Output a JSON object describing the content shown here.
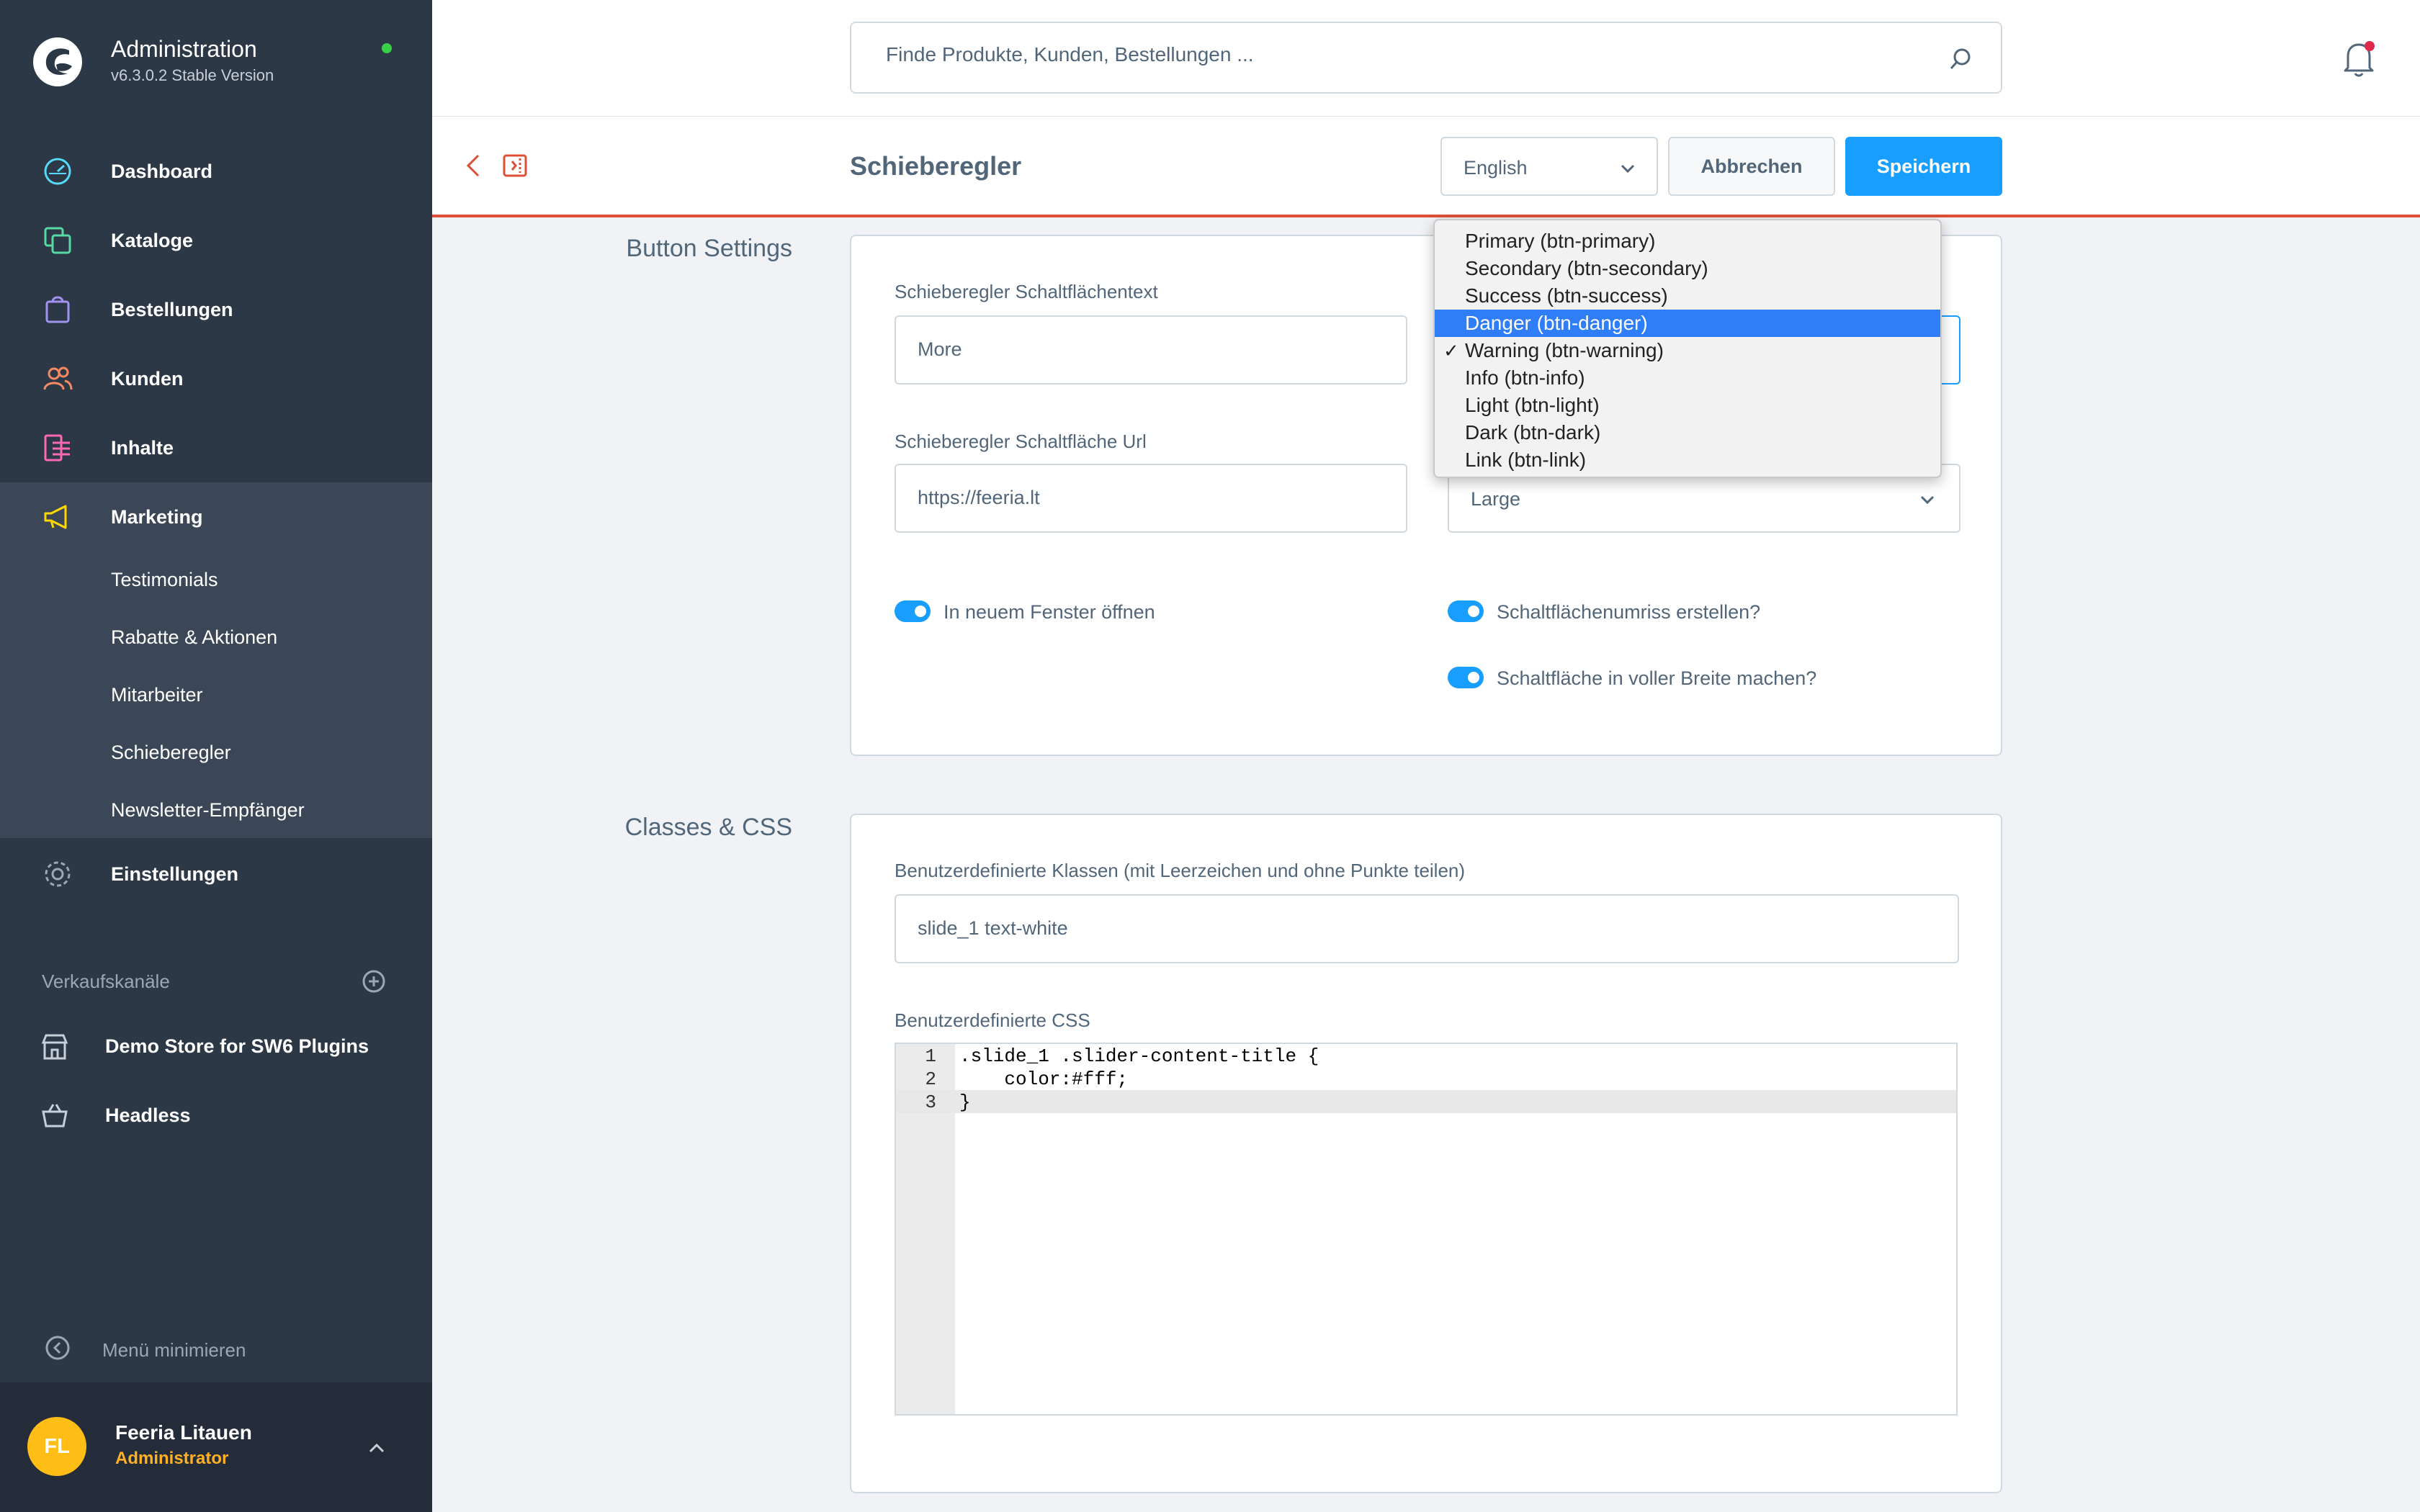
{
  "brand": {
    "title": "Administration",
    "version": "v6.3.0.2 Stable Version",
    "status_color": "#37d046"
  },
  "nav": {
    "items": [
      {
        "label": "Dashboard",
        "icon": "dashboard-icon",
        "color": "#57d9f7"
      },
      {
        "label": "Kataloge",
        "icon": "catalog-icon",
        "color": "#57d9a3"
      },
      {
        "label": "Bestellungen",
        "icon": "orders-icon",
        "color": "#a092f0"
      },
      {
        "label": "Kunden",
        "icon": "customers-icon",
        "color": "#f88962"
      },
      {
        "label": "Inhalte",
        "icon": "content-icon",
        "color": "#ff68b4"
      },
      {
        "label": "Marketing",
        "icon": "marketing-icon",
        "color": "#ffd700"
      },
      {
        "label": "Einstellungen",
        "icon": "settings-icon",
        "color": "#9aa8b5"
      }
    ],
    "marketing_sub": [
      {
        "label": "Testimonials"
      },
      {
        "label": "Rabatte & Aktionen"
      },
      {
        "label": "Mitarbeiter"
      },
      {
        "label": "Schieberegler"
      },
      {
        "label": "Newsletter-Empfänger"
      }
    ]
  },
  "sales_channels": {
    "heading": "Verkaufskanäle",
    "items": [
      {
        "label": "Demo Store for SW6 Plugins",
        "icon": "storefront-icon"
      },
      {
        "label": "Headless",
        "icon": "basket-icon"
      }
    ]
  },
  "minimize_label": "Menü minimieren",
  "user": {
    "initials": "FL",
    "name": "Feeria Litauen",
    "role": "Administrator"
  },
  "search": {
    "placeholder": "Finde Produkte, Kunden, Bestellungen ..."
  },
  "smartbar": {
    "title": "Schieberegler",
    "language": "English",
    "cancel_label": "Abbrechen",
    "save_label": "Speichern",
    "accent_color": "#de4f38",
    "primary_color": "#189eff"
  },
  "button_settings": {
    "section_label": "Button Settings",
    "text_label": "Schieberegler Schaltflächentext",
    "text_value": "More",
    "url_label": "Schieberegler Schaltfläche Url",
    "url_value": "https://feeria.lt",
    "size_value": "Large",
    "toggle_new_window": "In neuem Fenster öffnen",
    "toggle_outline": "Schaltflächenumriss erstellen?",
    "toggle_full_width": "Schaltfläche in voller Breite machen?"
  },
  "variant_dropdown": {
    "options": [
      "Primary (btn-primary)",
      "Secondary (btn-secondary)",
      "Success (btn-success)",
      "Danger (btn-danger)",
      "Warning (btn-warning)",
      "Info (btn-info)",
      "Light (btn-light)",
      "Dark (btn-dark)",
      "Link (btn-link)"
    ],
    "highlighted": "Danger (btn-danger)",
    "selected": "Warning (btn-warning)",
    "check_glyph": "✓"
  },
  "classes_css": {
    "section_label": "Classes & CSS",
    "classes_label": "Benutzerdefinierte Klassen (mit Leerzeichen und ohne Punkte teilen)",
    "classes_value": "slide_1 text-white",
    "css_label": "Benutzerdefinierte CSS",
    "css_lines": [
      {
        "no": "1",
        "text": ".slide_1 .slider-content-title {"
      },
      {
        "no": "2",
        "text": "    color:#fff;"
      },
      {
        "no": "3",
        "text": "}"
      }
    ]
  }
}
